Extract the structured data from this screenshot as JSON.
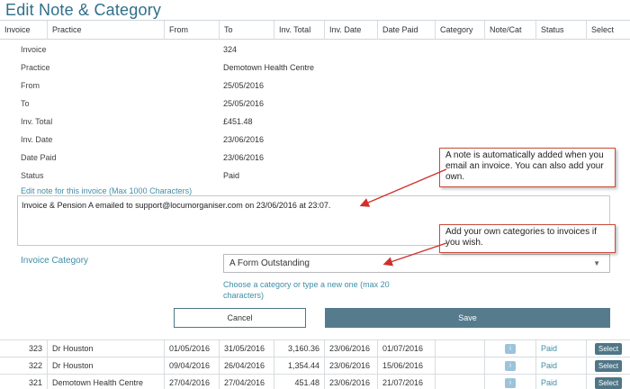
{
  "title": "Edit Note & Category",
  "columns": [
    "Invoice",
    "Practice",
    "From",
    "To",
    "Inv. Total",
    "Inv. Date",
    "Date Paid",
    "Category",
    "Note/Cat",
    "Status",
    "Select"
  ],
  "details": [
    {
      "label": "Invoice",
      "value": "324"
    },
    {
      "label": "Practice",
      "value": "Demotown Health Centre"
    },
    {
      "label": "From",
      "value": "25/05/2016"
    },
    {
      "label": "To",
      "value": "25/05/2016"
    },
    {
      "label": "Inv. Total",
      "value": "£451.48"
    },
    {
      "label": "Inv. Date",
      "value": "23/06/2016"
    },
    {
      "label": "Date Paid",
      "value": "23/06/2016"
    },
    {
      "label": "Status",
      "value": "Paid"
    }
  ],
  "note": {
    "label": "Edit note for this invoice  (Max 1000 Characters)",
    "value": "Invoice & Pension A emailed to support@locumorganiser.com on 23/06/2016 at 23:07."
  },
  "category": {
    "label": "Invoice Category",
    "value": "A Form Outstanding",
    "hint": "Choose a category or type a new one (max 20 characters)"
  },
  "buttons": {
    "cancel": "Cancel",
    "save": "Save"
  },
  "callouts": {
    "note": "A note is automatically added when you email an invoice. You can also add your own.",
    "category": "Add your own categories to invoices if you wish."
  },
  "rows": [
    {
      "invoice": "323",
      "practice": "Dr Houston",
      "from": "01/05/2016",
      "to": "31/05/2016",
      "total": "3,160.36",
      "inv_date": "23/06/2016",
      "paid": "01/07/2016",
      "category": "",
      "info": "i",
      "status": "Paid",
      "select": "Select"
    },
    {
      "invoice": "322",
      "practice": "Dr Houston",
      "from": "09/04/2016",
      "to": "26/04/2016",
      "total": "1,354.44",
      "inv_date": "23/06/2016",
      "paid": "15/06/2016",
      "category": "",
      "info": "i",
      "status": "Paid",
      "select": "Select"
    },
    {
      "invoice": "321",
      "practice": "Demotown Health Centre",
      "from": "27/04/2016",
      "to": "27/04/2016",
      "total": "451.48",
      "inv_date": "23/06/2016",
      "paid": "21/07/2016",
      "category": "",
      "info": "i",
      "status": "Paid",
      "select": "Select"
    }
  ],
  "colors": {
    "accent": "#3f8ea6",
    "button": "#567b8d",
    "callout_border": "#c74b3b"
  }
}
